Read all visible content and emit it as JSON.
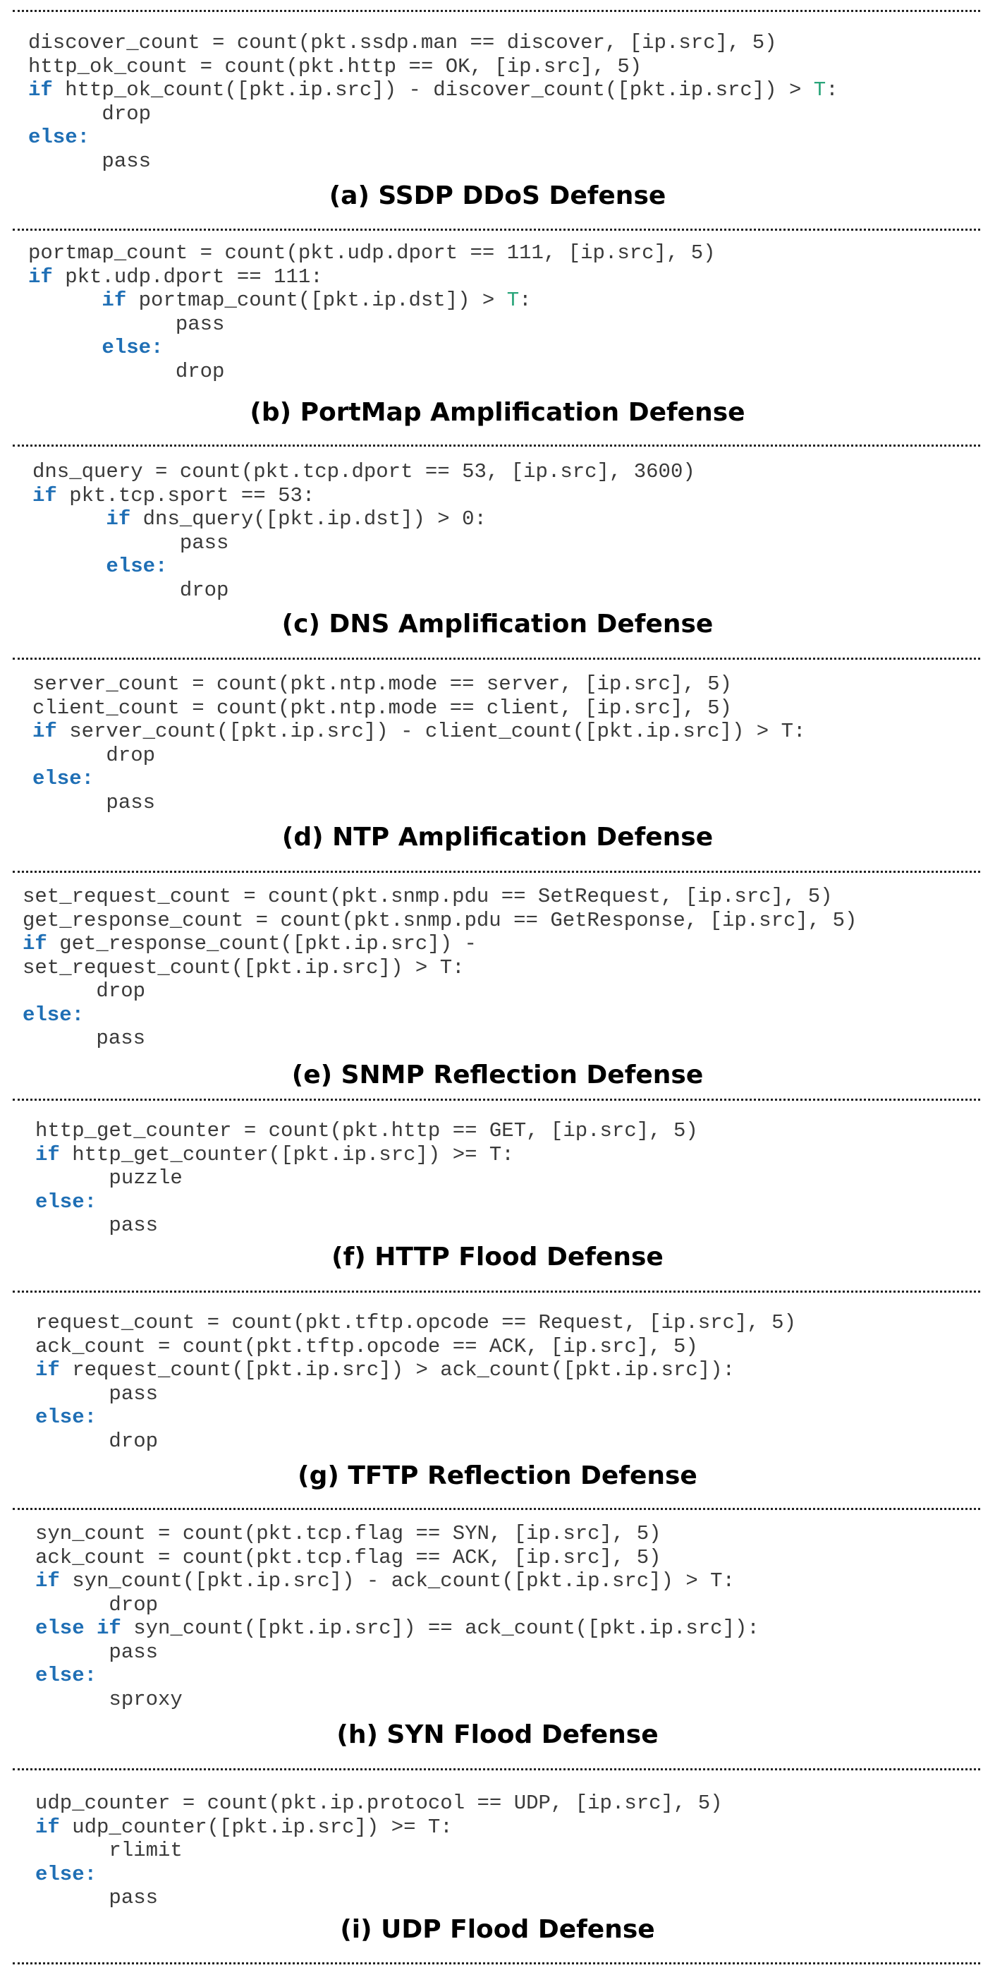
{
  "colors": {
    "keyword": "#1f6fb5",
    "threshold_highlight": "#2aa57a",
    "code_text": "#3a3a3a",
    "caption_text": "#000000"
  },
  "sections": [
    {
      "caption": "(a) SSDP DDoS Defense",
      "lines": [
        [
          {
            "t": "discover_count = count(pkt.ssdp.man == discover, [ip.src], 5)"
          }
        ],
        [
          {
            "t": "http_ok_count = count(pkt.http == OK, [ip.src], 5)"
          }
        ],
        [
          {
            "t": "if",
            "k": 1
          },
          {
            "t": " http_ok_count([pkt.ip.src]) - discover_count([pkt.ip.src]) > "
          },
          {
            "t": "T",
            "g": 1
          },
          {
            "t": ":"
          }
        ],
        [
          {
            "t": "      drop"
          }
        ],
        [
          {
            "t": "else:",
            "k": 1
          }
        ],
        [
          {
            "t": "      pass"
          }
        ]
      ]
    },
    {
      "caption": "(b) PortMap Amplification Defense",
      "lines": [
        [
          {
            "t": "portmap_count = count(pkt.udp.dport == 111, [ip.src], 5)"
          }
        ],
        [
          {
            "t": "if",
            "k": 1
          },
          {
            "t": " pkt.udp.dport == 111:"
          }
        ],
        [
          {
            "t": "      "
          },
          {
            "t": "if",
            "k": 1
          },
          {
            "t": " portmap_count([pkt.ip.dst]) > "
          },
          {
            "t": "T",
            "g": 1
          },
          {
            "t": ":"
          }
        ],
        [
          {
            "t": "            pass"
          }
        ],
        [
          {
            "t": "      "
          },
          {
            "t": "else:",
            "k": 1
          }
        ],
        [
          {
            "t": "            drop"
          }
        ]
      ]
    },
    {
      "caption": "(c) DNS Amplification Defense",
      "lines": [
        [
          {
            "t": "dns_query = count(pkt.tcp.dport == 53, [ip.src], 3600)"
          }
        ],
        [
          {
            "t": "if",
            "k": 1
          },
          {
            "t": " pkt.tcp.sport == 53:"
          }
        ],
        [
          {
            "t": "      "
          },
          {
            "t": "if",
            "k": 1
          },
          {
            "t": " dns_query([pkt.ip.dst]) > 0:"
          }
        ],
        [
          {
            "t": "            pass"
          }
        ],
        [
          {
            "t": "      "
          },
          {
            "t": "else:",
            "k": 1
          }
        ],
        [
          {
            "t": "            drop"
          }
        ]
      ]
    },
    {
      "caption": "(d) NTP Amplification Defense",
      "lines": [
        [
          {
            "t": "server_count = count(pkt.ntp.mode == server, [ip.src], 5)"
          }
        ],
        [
          {
            "t": "client_count = count(pkt.ntp.mode == client, [ip.src], 5)"
          }
        ],
        [
          {
            "t": "if",
            "k": 1
          },
          {
            "t": " server_count([pkt.ip.src]) - client_count([pkt.ip.src]) > T:"
          }
        ],
        [
          {
            "t": "      drop"
          }
        ],
        [
          {
            "t": "else:",
            "k": 1
          }
        ],
        [
          {
            "t": "      pass"
          }
        ]
      ]
    },
    {
      "caption": "(e) SNMP Reflection Defense",
      "lines": [
        [
          {
            "t": "set_request_count = count(pkt.snmp.pdu == SetRequest, [ip.src], 5)"
          }
        ],
        [
          {
            "t": "get_response_count = count(pkt.snmp.pdu == GetResponse, [ip.src], 5)"
          }
        ],
        [
          {
            "t": "if",
            "k": 1
          },
          {
            "t": " get_response_count([pkt.ip.src]) -"
          }
        ],
        [
          {
            "t": "set_request_count([pkt.ip.src]) > T:"
          }
        ],
        [
          {
            "t": "      drop"
          }
        ],
        [
          {
            "t": "else:",
            "k": 1
          }
        ],
        [
          {
            "t": "      pass"
          }
        ]
      ]
    },
    {
      "caption": "(f) HTTP Flood Defense",
      "lines": [
        [
          {
            "t": "http_get_counter = count(pkt.http == GET, [ip.src], 5)"
          }
        ],
        [
          {
            "t": "if",
            "k": 1
          },
          {
            "t": " http_get_counter([pkt.ip.src]) >= T:"
          }
        ],
        [
          {
            "t": "      puzzle"
          }
        ],
        [
          {
            "t": "else:",
            "k": 1
          }
        ],
        [
          {
            "t": "      pass"
          }
        ]
      ]
    },
    {
      "caption": "(g) TFTP Reflection Defense",
      "lines": [
        [
          {
            "t": "request_count = count(pkt.tftp.opcode == Request, [ip.src], 5)"
          }
        ],
        [
          {
            "t": "ack_count = count(pkt.tftp.opcode == ACK, [ip.src], 5)"
          }
        ],
        [
          {
            "t": "if",
            "k": 1
          },
          {
            "t": " request_count([pkt.ip.src]) > ack_count([pkt.ip.src]):"
          }
        ],
        [
          {
            "t": "      pass"
          }
        ],
        [
          {
            "t": "else:",
            "k": 1
          }
        ],
        [
          {
            "t": "      drop"
          }
        ]
      ]
    },
    {
      "caption": "(h) SYN Flood Defense",
      "lines": [
        [
          {
            "t": "syn_count = count(pkt.tcp.flag == SYN, [ip.src], 5)"
          }
        ],
        [
          {
            "t": "ack_count = count(pkt.tcp.flag == ACK, [ip.src], 5)"
          }
        ],
        [
          {
            "t": "if",
            "k": 1
          },
          {
            "t": " syn_count([pkt.ip.src]) - ack_count([pkt.ip.src]) > T:"
          }
        ],
        [
          {
            "t": "      drop"
          }
        ],
        [
          {
            "t": "else if",
            "k": 1
          },
          {
            "t": " syn_count([pkt.ip.src]) == ack_count([pkt.ip.src]):"
          }
        ],
        [
          {
            "t": "      pass"
          }
        ],
        [
          {
            "t": "else:",
            "k": 1
          }
        ],
        [
          {
            "t": "      sproxy"
          }
        ]
      ]
    },
    {
      "caption": "(i) UDP Flood Defense",
      "lines": [
        [
          {
            "t": "udp_counter = count(pkt.ip.protocol == UDP, [ip.src], 5)"
          }
        ],
        [
          {
            "t": "if",
            "k": 1
          },
          {
            "t": " udp_counter([pkt.ip.src]) >= T:"
          }
        ],
        [
          {
            "t": "      rlimit"
          }
        ],
        [
          {
            "t": "else:",
            "k": 1
          }
        ],
        [
          {
            "t": "      pass"
          }
        ]
      ]
    }
  ]
}
